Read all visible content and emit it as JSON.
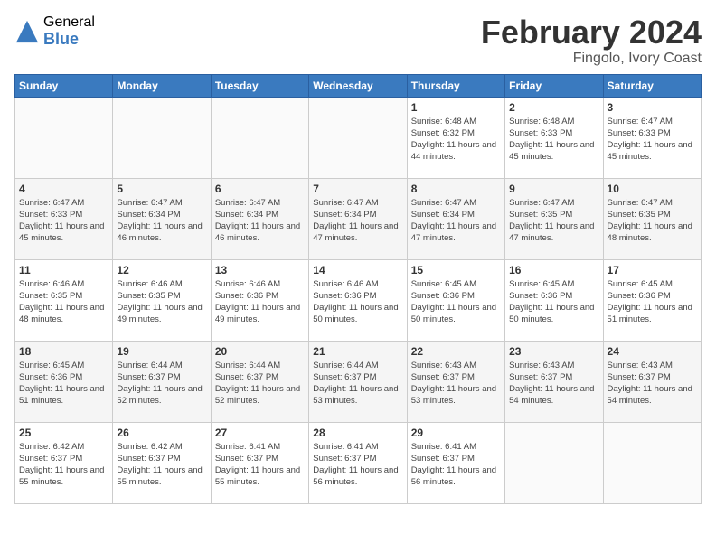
{
  "logo": {
    "general": "General",
    "blue": "Blue"
  },
  "title": "February 2024",
  "location": "Fingolo, Ivory Coast",
  "days_of_week": [
    "Sunday",
    "Monday",
    "Tuesday",
    "Wednesday",
    "Thursday",
    "Friday",
    "Saturday"
  ],
  "weeks": [
    [
      {
        "day": "",
        "info": ""
      },
      {
        "day": "",
        "info": ""
      },
      {
        "day": "",
        "info": ""
      },
      {
        "day": "",
        "info": ""
      },
      {
        "day": "1",
        "info": "Sunrise: 6:48 AM\nSunset: 6:32 PM\nDaylight: 11 hours and 44 minutes."
      },
      {
        "day": "2",
        "info": "Sunrise: 6:48 AM\nSunset: 6:33 PM\nDaylight: 11 hours and 45 minutes."
      },
      {
        "day": "3",
        "info": "Sunrise: 6:47 AM\nSunset: 6:33 PM\nDaylight: 11 hours and 45 minutes."
      }
    ],
    [
      {
        "day": "4",
        "info": "Sunrise: 6:47 AM\nSunset: 6:33 PM\nDaylight: 11 hours and 45 minutes."
      },
      {
        "day": "5",
        "info": "Sunrise: 6:47 AM\nSunset: 6:34 PM\nDaylight: 11 hours and 46 minutes."
      },
      {
        "day": "6",
        "info": "Sunrise: 6:47 AM\nSunset: 6:34 PM\nDaylight: 11 hours and 46 minutes."
      },
      {
        "day": "7",
        "info": "Sunrise: 6:47 AM\nSunset: 6:34 PM\nDaylight: 11 hours and 47 minutes."
      },
      {
        "day": "8",
        "info": "Sunrise: 6:47 AM\nSunset: 6:34 PM\nDaylight: 11 hours and 47 minutes."
      },
      {
        "day": "9",
        "info": "Sunrise: 6:47 AM\nSunset: 6:35 PM\nDaylight: 11 hours and 47 minutes."
      },
      {
        "day": "10",
        "info": "Sunrise: 6:47 AM\nSunset: 6:35 PM\nDaylight: 11 hours and 48 minutes."
      }
    ],
    [
      {
        "day": "11",
        "info": "Sunrise: 6:46 AM\nSunset: 6:35 PM\nDaylight: 11 hours and 48 minutes."
      },
      {
        "day": "12",
        "info": "Sunrise: 6:46 AM\nSunset: 6:35 PM\nDaylight: 11 hours and 49 minutes."
      },
      {
        "day": "13",
        "info": "Sunrise: 6:46 AM\nSunset: 6:36 PM\nDaylight: 11 hours and 49 minutes."
      },
      {
        "day": "14",
        "info": "Sunrise: 6:46 AM\nSunset: 6:36 PM\nDaylight: 11 hours and 50 minutes."
      },
      {
        "day": "15",
        "info": "Sunrise: 6:45 AM\nSunset: 6:36 PM\nDaylight: 11 hours and 50 minutes."
      },
      {
        "day": "16",
        "info": "Sunrise: 6:45 AM\nSunset: 6:36 PM\nDaylight: 11 hours and 50 minutes."
      },
      {
        "day": "17",
        "info": "Sunrise: 6:45 AM\nSunset: 6:36 PM\nDaylight: 11 hours and 51 minutes."
      }
    ],
    [
      {
        "day": "18",
        "info": "Sunrise: 6:45 AM\nSunset: 6:36 PM\nDaylight: 11 hours and 51 minutes."
      },
      {
        "day": "19",
        "info": "Sunrise: 6:44 AM\nSunset: 6:37 PM\nDaylight: 11 hours and 52 minutes."
      },
      {
        "day": "20",
        "info": "Sunrise: 6:44 AM\nSunset: 6:37 PM\nDaylight: 11 hours and 52 minutes."
      },
      {
        "day": "21",
        "info": "Sunrise: 6:44 AM\nSunset: 6:37 PM\nDaylight: 11 hours and 53 minutes."
      },
      {
        "day": "22",
        "info": "Sunrise: 6:43 AM\nSunset: 6:37 PM\nDaylight: 11 hours and 53 minutes."
      },
      {
        "day": "23",
        "info": "Sunrise: 6:43 AM\nSunset: 6:37 PM\nDaylight: 11 hours and 54 minutes."
      },
      {
        "day": "24",
        "info": "Sunrise: 6:43 AM\nSunset: 6:37 PM\nDaylight: 11 hours and 54 minutes."
      }
    ],
    [
      {
        "day": "25",
        "info": "Sunrise: 6:42 AM\nSunset: 6:37 PM\nDaylight: 11 hours and 55 minutes."
      },
      {
        "day": "26",
        "info": "Sunrise: 6:42 AM\nSunset: 6:37 PM\nDaylight: 11 hours and 55 minutes."
      },
      {
        "day": "27",
        "info": "Sunrise: 6:41 AM\nSunset: 6:37 PM\nDaylight: 11 hours and 55 minutes."
      },
      {
        "day": "28",
        "info": "Sunrise: 6:41 AM\nSunset: 6:37 PM\nDaylight: 11 hours and 56 minutes."
      },
      {
        "day": "29",
        "info": "Sunrise: 6:41 AM\nSunset: 6:37 PM\nDaylight: 11 hours and 56 minutes."
      },
      {
        "day": "",
        "info": ""
      },
      {
        "day": "",
        "info": ""
      }
    ]
  ]
}
